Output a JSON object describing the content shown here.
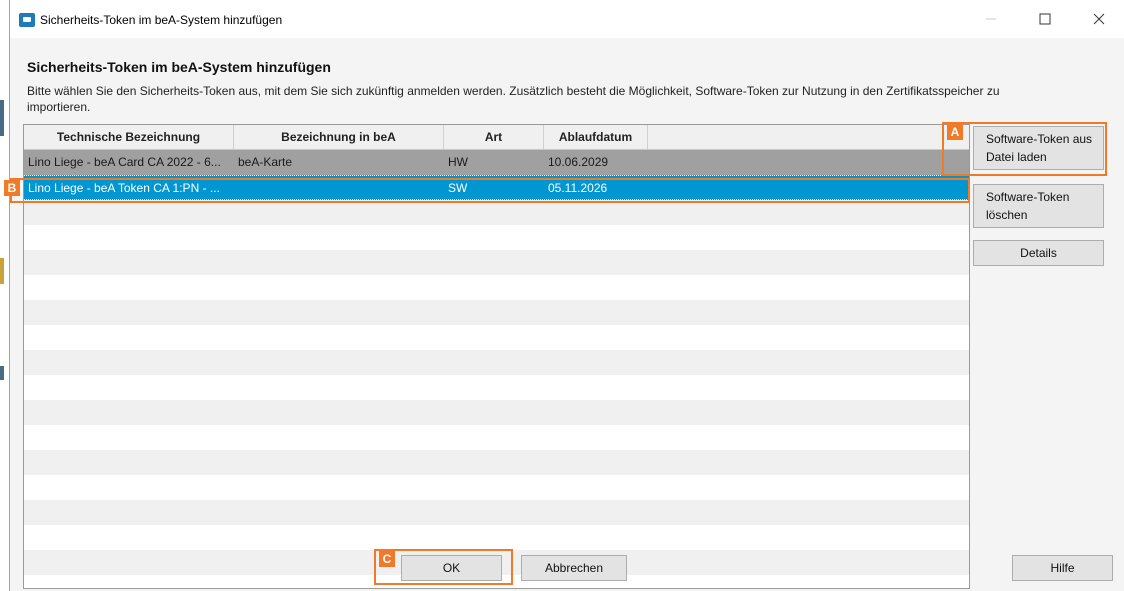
{
  "window": {
    "title": "Sicherheits-Token im beA-System hinzufügen",
    "minimize_icon": "minimize-icon",
    "maximize_icon": "maximize-icon",
    "close_icon": "close-icon"
  },
  "dialog": {
    "heading": "Sicherheits-Token im beA-System hinzufügen",
    "description": "Bitte wählen Sie den Sicherheits-Token aus, mit dem Sie sich zukünftig anmelden werden. Zusätzlich besteht die Möglichkeit, Software-Token zur Nutzung in den Zertifikatsspeicher zu importieren."
  },
  "table": {
    "columns": [
      "Technische Bezeichnung",
      "Bezeichnung in beA",
      "Art",
      "Ablaufdatum",
      ""
    ],
    "rows": [
      [
        "Lino Liege - beA Card CA 2022 - 6...",
        "beA-Karte",
        "HW",
        "10.06.2029"
      ],
      [
        "Lino Liege - beA Token CA 1:PN - ...",
        "",
        "SW",
        "05.11.2026"
      ]
    ]
  },
  "buttons": {
    "load_token": "Software-Token aus Datei laden",
    "delete_token": "Software-Token löschen",
    "details": "Details",
    "ok": "OK",
    "cancel": "Abbrechen",
    "help": "Hilfe"
  },
  "markers": {
    "a": "A",
    "b": "B",
    "c": "C"
  },
  "colors": {
    "accent_marker": "#f07a28",
    "selected_row": "#0096d2",
    "hw_row": "#a0a0a0"
  }
}
